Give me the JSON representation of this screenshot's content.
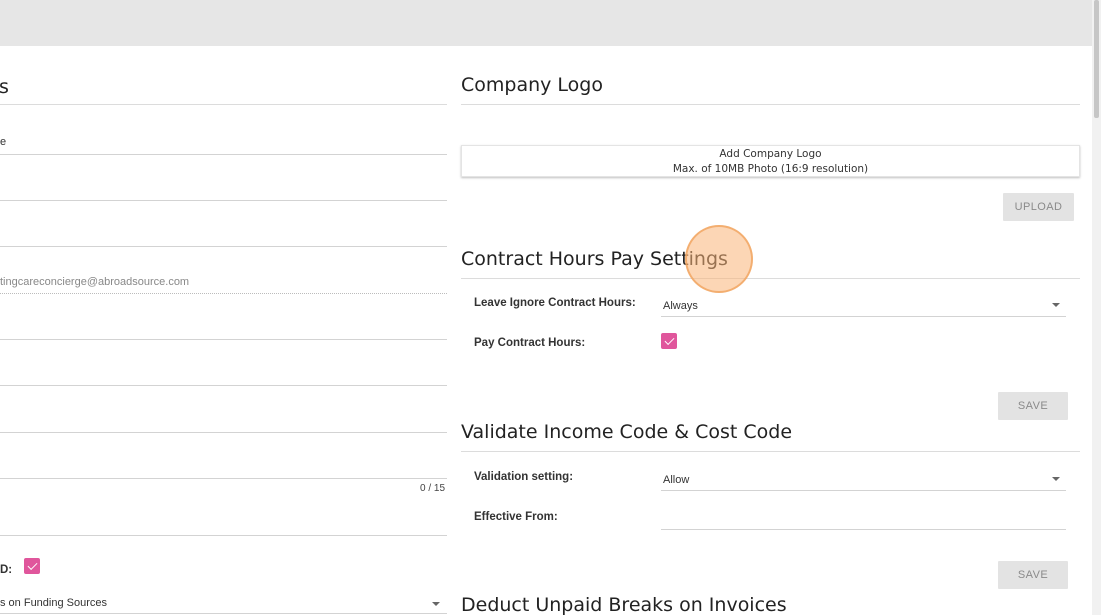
{
  "left": {
    "section_title_tail": "s",
    "first_field_tail": "e",
    "email_value": "tingcareconcierge@abroadsource.com",
    "char_counter": "0 / 15",
    "checkbox_label_tail": "D:",
    "funding_select_value": "s on Funding Sources"
  },
  "company_logo": {
    "title": "Company Logo",
    "add_label": "Add Company Logo",
    "size_hint": "Max. of 10MB Photo (16:9 resolution)",
    "upload_label": "UPLOAD"
  },
  "contract_hours": {
    "title": "Contract Hours Pay Settings",
    "leave_label": "Leave Ignore Contract Hours:",
    "leave_value": "Always",
    "pay_label": "Pay Contract Hours:",
    "save_label": "SAVE"
  },
  "validate": {
    "title": "Validate Income Code & Cost Code",
    "setting_label": "Validation setting:",
    "setting_value": "Allow",
    "effective_label": "Effective From:",
    "save_label": "SAVE"
  },
  "deduct": {
    "title": "Deduct Unpaid Breaks on Invoices"
  },
  "colors": {
    "checkbox": "#e0569c",
    "button_bg": "#e3e3e3",
    "topbar": "#e6e6e6"
  }
}
